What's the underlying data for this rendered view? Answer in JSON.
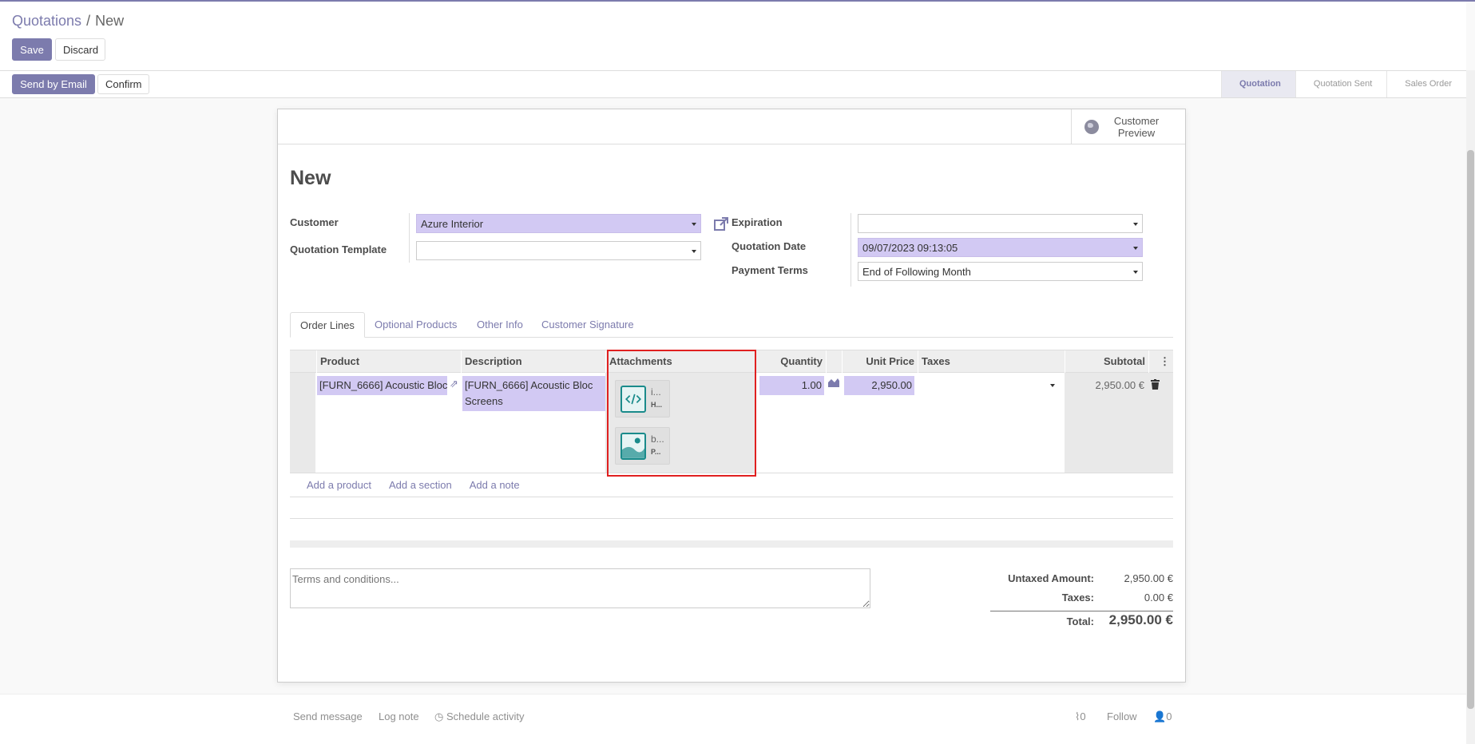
{
  "breadcrumb": {
    "parent": "Quotations",
    "separator": "/",
    "current": "New"
  },
  "toolbar": {
    "save_label": "Save",
    "discard_label": "Discard"
  },
  "actions": {
    "send_email_label": "Send by Email",
    "confirm_label": "Confirm"
  },
  "status_stages": [
    {
      "label": "Quotation",
      "active": true
    },
    {
      "label": "Quotation Sent",
      "active": false
    },
    {
      "label": "Sales Order",
      "active": false
    }
  ],
  "smart_button": {
    "label": "Customer Preview",
    "icon": "globe-icon"
  },
  "form": {
    "title": "New",
    "customer_label": "Customer",
    "customer_value": "Azure Interior",
    "template_label": "Quotation Template",
    "template_value": "",
    "expiration_label": "Expiration",
    "expiration_value": "",
    "date_label": "Quotation Date",
    "date_value": "09/07/2023 09:13:05",
    "terms_label": "Payment Terms",
    "terms_value": "End of Following Month"
  },
  "tabs": [
    "Order Lines",
    "Optional Products",
    "Other Info",
    "Customer Signature"
  ],
  "table": {
    "headers": {
      "product": "Product",
      "description": "Description",
      "attachments": "Attachments",
      "quantity": "Quantity",
      "unit_price": "Unit Price",
      "taxes": "Taxes",
      "subtotal": "Subtotal"
    },
    "row": {
      "product": "[FURN_6666] Acoustic Bloc",
      "description": "[FURN_6666] Acoustic Bloc Screens",
      "quantity": "1.00",
      "unit_price": "2,950.00",
      "taxes": "",
      "subtotal": "2,950.00 €",
      "attachments": [
        {
          "name": "i...",
          "type": "H...",
          "icon": "code-file-icon"
        },
        {
          "name": "b...",
          "type": "P...",
          "icon": "image-file-icon"
        }
      ]
    }
  },
  "add_links": {
    "product": "Add a product",
    "section": "Add a section",
    "note": "Add a note"
  },
  "terms_placeholder": "Terms and conditions...",
  "totals": {
    "untaxed_label": "Untaxed Amount:",
    "untaxed_value": "2,950.00 €",
    "taxes_label": "Taxes:",
    "taxes_value": "0.00 €",
    "total_label": "Total:",
    "total_value": "2,950.00 €"
  },
  "chatter": {
    "send_message": "Send message",
    "log_note": "Log note",
    "schedule_activity": "Schedule activity",
    "attachment_count": "0",
    "follow": "Follow",
    "follower_count": "0"
  },
  "colors": {
    "brand": "#7c7bad",
    "required_field": "#d2c9f3",
    "highlight": "#e02020"
  }
}
